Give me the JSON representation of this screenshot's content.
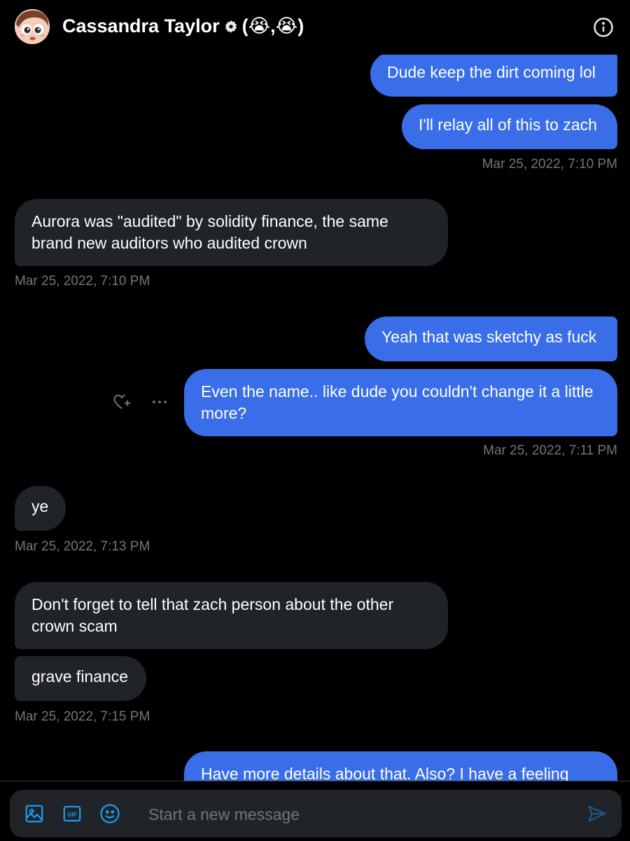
{
  "header": {
    "name": "Cassandra Taylor",
    "emoji_suffix": "(😭,😭)"
  },
  "messages": [
    {
      "side": "out",
      "text": "Dude keep the dirt coming lol"
    },
    {
      "side": "out",
      "text": "I'll relay all of this to zach"
    },
    {
      "side": "out",
      "timestamp": "Mar 25, 2022, 7:10 PM"
    },
    {
      "side": "in",
      "text": "Aurora was \"audited\" by solidity finance, the same brand new auditors who audited crown"
    },
    {
      "side": "in",
      "timestamp": "Mar 25, 2022, 7:10 PM"
    },
    {
      "side": "out",
      "text": "Yeah that was sketchy as fuck"
    },
    {
      "side": "out",
      "text": "Even the name.. like dude you couldn't change it a little more?"
    },
    {
      "side": "out",
      "timestamp": "Mar 25, 2022, 7:11 PM"
    },
    {
      "side": "in",
      "text": "ye"
    },
    {
      "side": "in",
      "timestamp": "Mar 25, 2022, 7:13 PM"
    },
    {
      "side": "in",
      "text": "Don't forget to tell that zach person about the other crown scam"
    },
    {
      "side": "in",
      "text": "grave finance"
    },
    {
      "side": "in",
      "timestamp": "Mar 25, 2022, 7:15 PM"
    },
    {
      "side": "out",
      "text": "Have more details about that. Also? I have a feeling"
    }
  ],
  "composer": {
    "placeholder": "Start a new message",
    "icons": [
      "image-icon",
      "gif-icon",
      "emoji-icon",
      "send-icon"
    ]
  },
  "message_actions": {
    "icons": [
      "react-heart-icon",
      "more-options-icon"
    ]
  },
  "colors": {
    "background": "#000000",
    "outgoing_bubble": "#3a6ee8",
    "incoming_bubble": "#202327",
    "timestamp": "#71767b",
    "accent": "#1d9bf0"
  }
}
